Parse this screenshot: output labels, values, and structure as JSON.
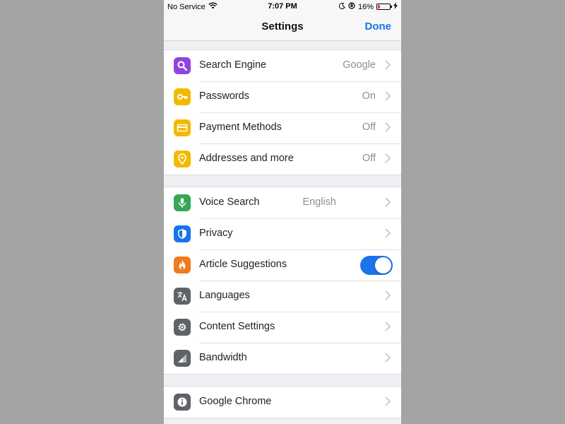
{
  "status_bar": {
    "carrier": "No Service",
    "time": "7:07 PM",
    "battery_percent": "16%",
    "battery_level": 0.16,
    "icons": [
      "wifi-icon",
      "moon-icon",
      "orientation-lock-icon",
      "battery-icon",
      "charging-icon"
    ]
  },
  "nav": {
    "title": "Settings",
    "done_label": "Done"
  },
  "groups": [
    {
      "rows": [
        {
          "label": "Search Engine",
          "value": "Google",
          "icon": "search-icon",
          "icon_color": "#8e44e0"
        },
        {
          "label": "Passwords",
          "value": "On",
          "icon": "key-icon",
          "icon_color": "#f5b800"
        },
        {
          "label": "Payment Methods",
          "value": "Off",
          "icon": "credit-card-icon",
          "icon_color": "#f5b800"
        },
        {
          "label": "Addresses and more",
          "value": "Off",
          "icon": "location-pin-icon",
          "icon_color": "#f5b800"
        }
      ]
    },
    {
      "rows": [
        {
          "label": "Voice Search",
          "value": "English",
          "icon": "microphone-icon",
          "icon_color": "#34a853"
        },
        {
          "label": "Privacy",
          "value": "",
          "icon": "shield-icon",
          "icon_color": "#1a73e8"
        },
        {
          "label": "Article Suggestions",
          "value": "",
          "icon": "flame-icon",
          "icon_color": "#f07a1e",
          "toggle_on": true
        },
        {
          "label": "Languages",
          "value": "",
          "icon": "translate-icon",
          "icon_color": "#5f6368"
        },
        {
          "label": "Content Settings",
          "value": "",
          "icon": "gear-icon",
          "icon_color": "#5f6368"
        },
        {
          "label": "Bandwidth",
          "value": "",
          "icon": "signal-icon",
          "icon_color": "#5f6368"
        }
      ]
    },
    {
      "rows": [
        {
          "label": "Google Chrome",
          "value": "",
          "icon": "info-icon",
          "icon_color": "#5f6368"
        }
      ]
    }
  ],
  "colors": {
    "accent": "#1a73e8",
    "background": "#a4a4a4",
    "grouped_background": "#efeff4"
  }
}
